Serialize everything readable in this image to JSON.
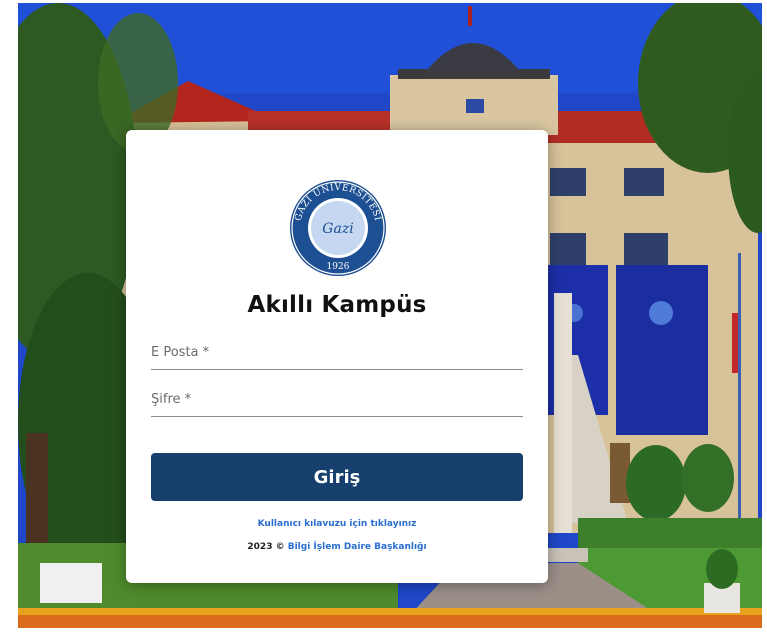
{
  "app": {
    "title": "Akıllı Kampüs",
    "logo": {
      "icon": "gazi-university-seal-icon",
      "top_text": "GAZİ ÜNİVERSİTESİ",
      "script_text": "Gazi",
      "year": "1926"
    }
  },
  "form": {
    "email_placeholder": "E Posta *",
    "email_value": "",
    "password_placeholder": "Şifre *",
    "password_value": "",
    "submit_label": "Giriş"
  },
  "links": {
    "guide_label": "Kullanıcı kılavuzu için tıklayınız"
  },
  "footer": {
    "prefix": "2023 ©",
    "org_label": "Bilgi İşlem Daire Başkanlığı"
  },
  "colors": {
    "primary_button": "#173f6d",
    "link": "#2a6fcf",
    "seal_blue": "#1d4f93"
  }
}
